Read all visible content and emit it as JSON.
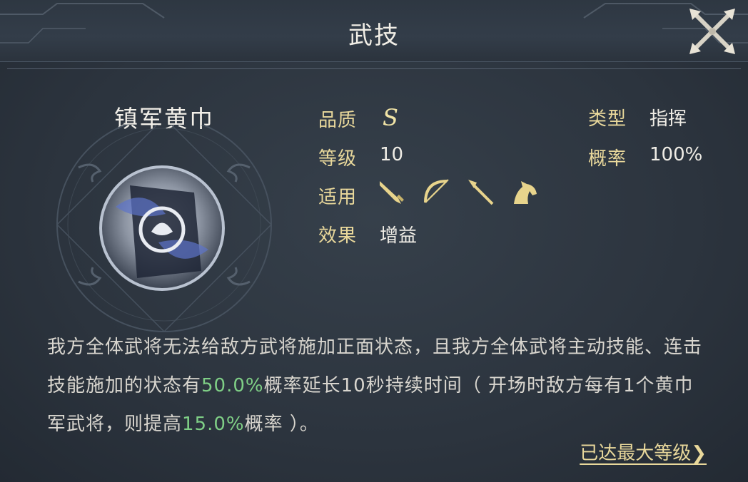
{
  "window": {
    "title": "武技"
  },
  "skill": {
    "name": "镇军黄巾",
    "attributes": {
      "quality_label": "品质",
      "quality_value": "S",
      "level_label": "等级",
      "level_value": "10",
      "applicable_label": "适用",
      "effect_label": "效果",
      "effect_value": "增益",
      "type_label": "类型",
      "type_value": "指挥",
      "probability_label": "概率",
      "probability_value": "100%"
    },
    "applicable_icons": [
      "sword-icon",
      "bow-icon",
      "spear-icon",
      "horse-icon"
    ],
    "description": {
      "part1": "我方全体武将无法给敌方武将施加正面状态，且我方全体武将主动技能、连击技能施加的状态有",
      "highlight1": "50.0%",
      "part2": "概率延长10秒持续时间（ 开场时敌方每有1个黄巾军武将，则提高",
      "highlight2": "15.0%",
      "part3": "概率 ）。"
    },
    "max_level_link": "已达最大等级❯"
  },
  "colors": {
    "label": "#e9d89b",
    "highlight": "#7fcf86",
    "background": "#2c343e"
  }
}
